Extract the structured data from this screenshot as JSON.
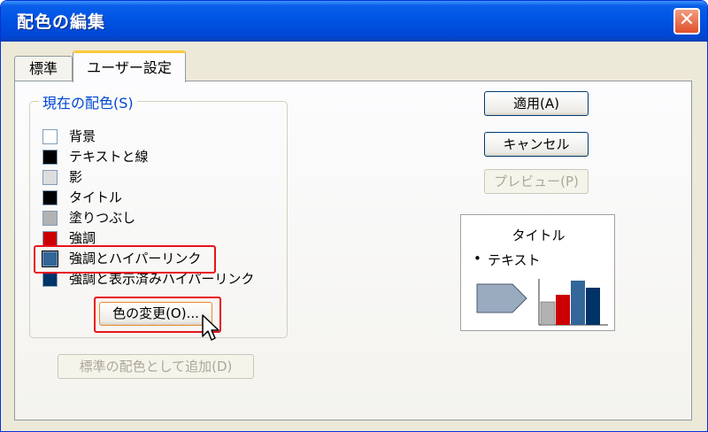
{
  "window": {
    "title": "配色の編集",
    "close_label": "✕"
  },
  "tabs": [
    {
      "label": "標準"
    },
    {
      "label": "ユーザー設定"
    }
  ],
  "scheme_group": {
    "label": "現在の配色(S)",
    "items": [
      {
        "label": "背景",
        "color": "#ffffff"
      },
      {
        "label": "テキストと線",
        "color": "#000000"
      },
      {
        "label": "影",
        "color": "#dddddd"
      },
      {
        "label": "タイトル",
        "color": "#000000"
      },
      {
        "label": "塗りつぶし",
        "color": "#b2b2b2"
      },
      {
        "label": "強調",
        "color": "#cc0000"
      },
      {
        "label": "強調とハイパーリンク",
        "color": "#336699"
      },
      {
        "label": "強調と表示済みハイパーリンク",
        "color": "#003366"
      }
    ],
    "change_button": "色の変更(O)..."
  },
  "add_standard_button": "標準の配色として追加(D)",
  "buttons": {
    "apply": "適用(A)",
    "cancel": "キャンセル",
    "preview": "プレビュー(P)"
  },
  "preview": {
    "title": "タイトル",
    "bullet": "•",
    "text": "テキスト"
  },
  "colors": {
    "titlebar": "#0055e5",
    "highlight": "#e8141c",
    "group_label": "#0046d5"
  }
}
